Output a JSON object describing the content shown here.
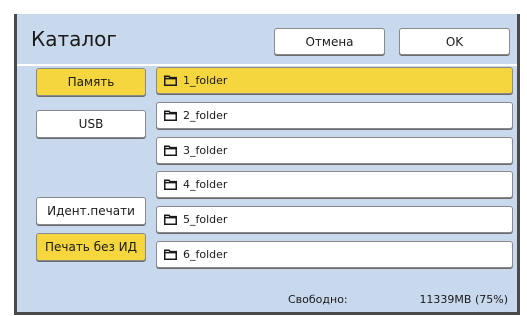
{
  "dialog": {
    "title": "Каталог",
    "cancel_label": "Отмена",
    "ok_label": "OK"
  },
  "sources": {
    "memory": "Память",
    "usb": "USB",
    "print_id": "Идент.печати",
    "print_no_id": "Печать без ИД"
  },
  "folders": [
    {
      "label": "1_folder",
      "selected": true
    },
    {
      "label": "2_folder",
      "selected": false
    },
    {
      "label": "3_folder",
      "selected": false
    },
    {
      "label": "4_folder",
      "selected": false
    },
    {
      "label": "5_folder",
      "selected": false
    },
    {
      "label": "6_folder",
      "selected": false
    }
  ],
  "status": {
    "free_label": "Свободно:",
    "free_value": "11339MB (75%)"
  },
  "colors": {
    "panel_bg": "#c8d9ee",
    "selected": "#f5d63f",
    "frame": "#4a4a4a"
  },
  "icons": {
    "folder": "folder-icon"
  }
}
